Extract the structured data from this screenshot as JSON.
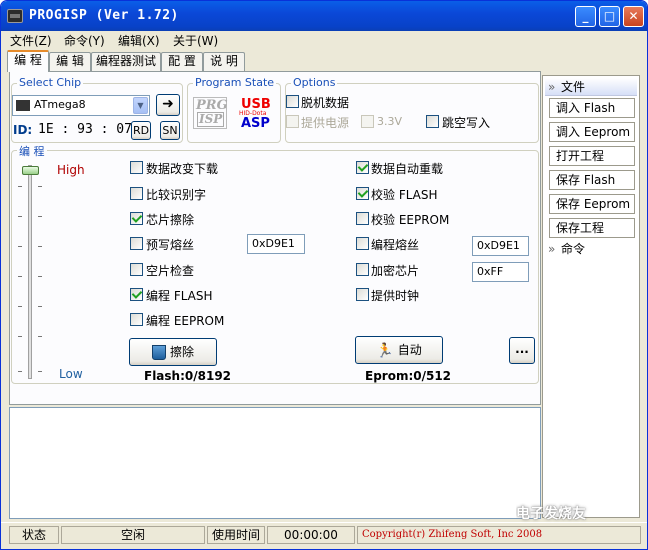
{
  "window": {
    "title": "PROGISP (Ver 1.72)",
    "min": "_",
    "max": "□",
    "close": "✕"
  },
  "menu": [
    "文件(Z)",
    "命令(Y)",
    "编辑(X)",
    "关于(W)"
  ],
  "tabs": [
    "编 程",
    "编 辑",
    "编程器测试",
    "配 置",
    "说 明"
  ],
  "select_chip": {
    "label": "Select Chip",
    "value": "ATmega8",
    "id_label": "ID:",
    "id_value": "1E : 93 : 07",
    "rd": "RD",
    "sn": "SN"
  },
  "program_state": {
    "label": "Program State",
    "prg": "PRG",
    "isp": "ISP",
    "usb": "USB",
    "hid": "HID-Dota",
    "asp": "ASP"
  },
  "options": {
    "label": "Options",
    "offline": "脱机数据",
    "power": "提供电源",
    "voltage": "3.3V",
    "skip": "跳空写入"
  },
  "program": {
    "label": "编 程",
    "high": "High",
    "low": "Low",
    "left": [
      "数据改变下载",
      "比较识别字",
      "芯片擦除",
      "预写熔丝",
      "空片检查",
      "编程 FLASH",
      "编程 EEPROM"
    ],
    "right": [
      "数据自动重载",
      "校验 FLASH",
      "校验 EEPROM",
      "编程熔丝",
      "加密芯片",
      "提供时钟"
    ],
    "fuse_left": "0xD9E1",
    "fuse_right": "0xD9E1",
    "lock": "0xFF",
    "erase": "擦除",
    "auto": "自动",
    "more": "...",
    "flash": "Flash:0/8192",
    "eeprom": "Eprom:0/512"
  },
  "sidebar": {
    "file_head": "文件",
    "items": [
      "调入 Flash",
      "调入 Eeprom",
      "打开工程",
      "保存 Flash",
      "保存 Eeprom",
      "保存工程"
    ],
    "cmd_head": "命令"
  },
  "status": {
    "state_label": "状态",
    "state": "空闲",
    "time_label": "使用时间",
    "time": "00:00:00",
    "copyright": "Copyright(r) Zhifeng Soft, Inc 2008",
    "watermark": "电子发烧友"
  }
}
